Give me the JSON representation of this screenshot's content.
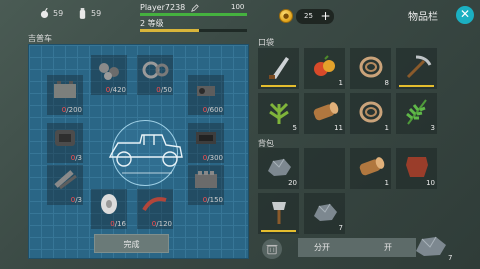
{
  "top": {
    "stat1": "59",
    "stat2": "59",
    "player_name": "Player7238",
    "hp": "100",
    "hp_fraction": 1.0,
    "level": "2 等级",
    "xp_fraction": 0.55,
    "coins": "25",
    "title": "物品栏"
  },
  "jeep": {
    "title": "吉普车",
    "finish_label": "完成",
    "parts": [
      {
        "name": "part-battery",
        "have": "0",
        "need": "/200"
      },
      {
        "name": "part-coils",
        "have": "0",
        "need": "/420"
      },
      {
        "name": "part-gears",
        "have": "0",
        "need": "/50"
      },
      {
        "name": "part-headlight",
        "have": "0",
        "need": "/600"
      },
      {
        "name": "part-carburetor",
        "have": "0",
        "need": "/3"
      },
      {
        "name": "part-generator",
        "have": "0",
        "need": "/300"
      },
      {
        "name": "part-shock",
        "have": "0",
        "need": "/3"
      },
      {
        "name": "part-engine-block",
        "have": "0",
        "need": "/150"
      },
      {
        "name": "part-wheel",
        "have": "0",
        "need": "/16"
      },
      {
        "name": "part-pipe",
        "have": "0",
        "need": "/120"
      }
    ]
  },
  "pockets": {
    "title": "口袋",
    "items": [
      {
        "name": "machete",
        "count": ""
      },
      {
        "name": "fruit",
        "count": "1"
      },
      {
        "name": "rope",
        "count": "8"
      },
      {
        "name": "pickaxe",
        "count": ""
      },
      {
        "name": "herb",
        "count": "5"
      },
      {
        "name": "log",
        "count": "11"
      },
      {
        "name": "rope",
        "count": "1"
      },
      {
        "name": "fern",
        "count": "3"
      }
    ]
  },
  "bag": {
    "title": "背包",
    "items": [
      {
        "name": "stone",
        "count": "20"
      },
      {
        "name": "empty",
        "count": ""
      },
      {
        "name": "log",
        "count": "1"
      },
      {
        "name": "leather",
        "count": "10"
      },
      {
        "name": "axe",
        "count": ""
      },
      {
        "name": "stone",
        "count": "7"
      }
    ],
    "split_left": "分开",
    "split_right": "开",
    "drag_count": "7"
  },
  "colors": {
    "accent": "#1bb0c2",
    "hp": "#45b13f",
    "xp": "#d8b53a",
    "need": "#ff4d4d"
  }
}
